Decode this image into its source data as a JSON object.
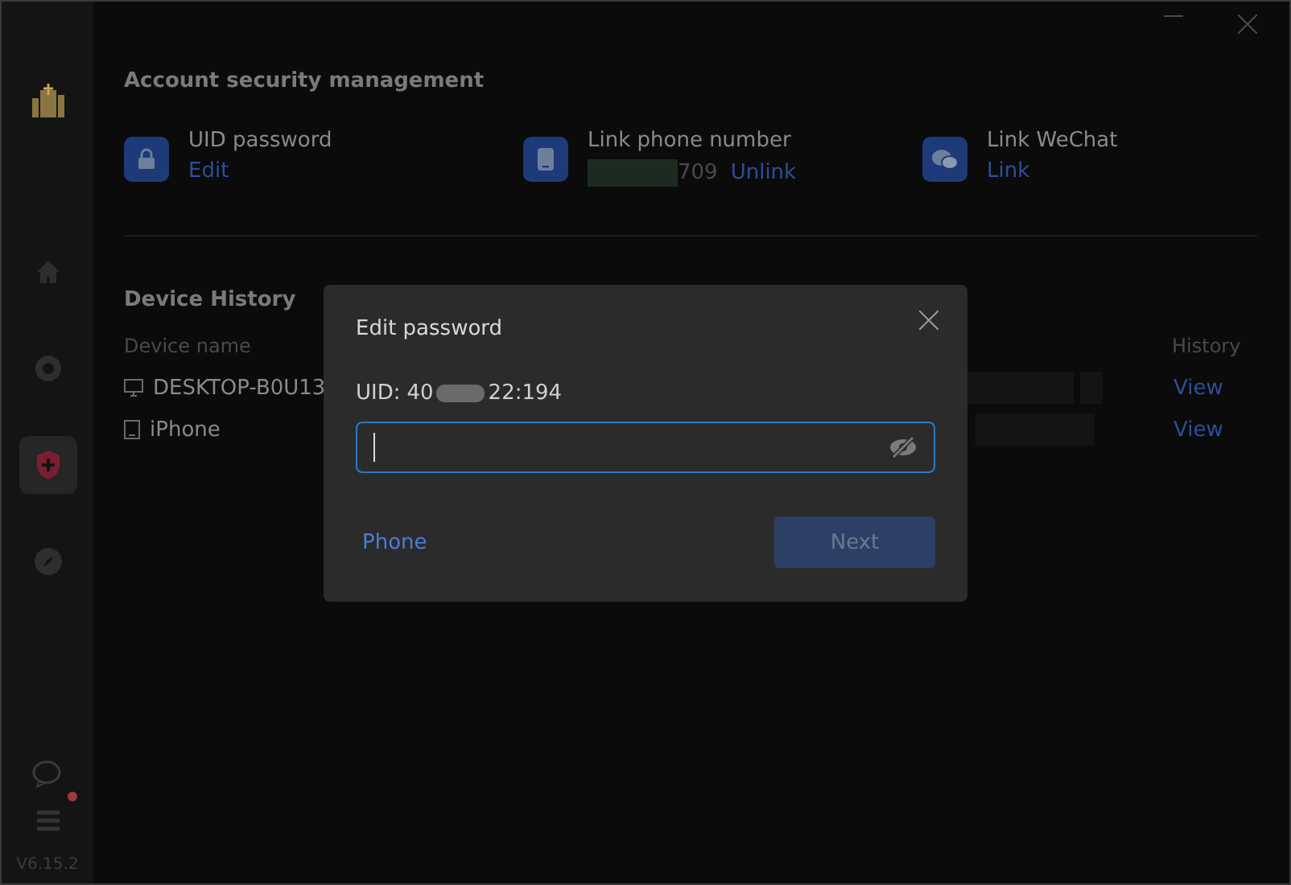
{
  "sidebar": {
    "nav": [
      {
        "kind": "home",
        "selected": false
      },
      {
        "kind": "camera",
        "selected": false
      },
      {
        "kind": "shield",
        "selected": true
      },
      {
        "kind": "compass",
        "selected": false
      }
    ],
    "menu_badge": true,
    "version": "V6.15.2"
  },
  "account": {
    "title": "Account security management",
    "items": [
      {
        "kind": "lock",
        "label": "UID password",
        "actions": [
          {
            "kind": "link",
            "text": "Edit"
          }
        ]
      },
      {
        "kind": "phone",
        "label": "Link phone number",
        "actions": [
          {
            "kind": "redacted",
            "text": "709"
          },
          {
            "kind": "link",
            "text": "Unlink"
          }
        ]
      },
      {
        "kind": "wechat",
        "label": "Link WeChat",
        "actions": [
          {
            "kind": "link",
            "text": "Link"
          }
        ]
      }
    ]
  },
  "devices": {
    "title": "Device History",
    "columns": [
      "Device name",
      "History"
    ],
    "rows": [
      {
        "kind": "desktop",
        "name": "DESKTOP-B0U13",
        "history": "View"
      },
      {
        "kind": "mobile",
        "name": "iPhone",
        "history": "View"
      }
    ]
  },
  "dialog": {
    "title": "Edit password",
    "uid_label": "UID:",
    "uid_start": "40",
    "uid_end": "22:194",
    "password_hidden": true,
    "switch_link": "Phone",
    "next_button": {
      "label": "Next",
      "disabled": true
    }
  }
}
